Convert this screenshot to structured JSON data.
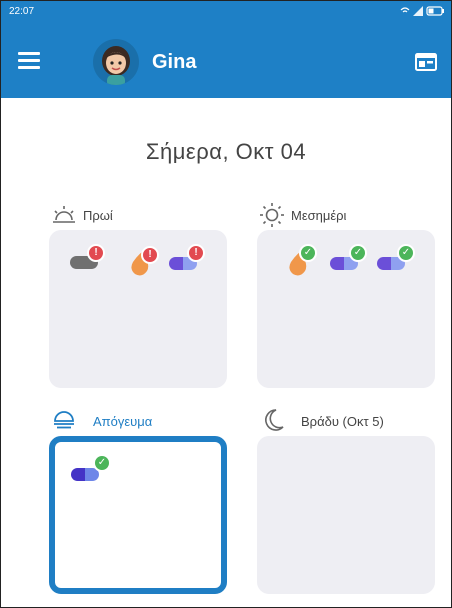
{
  "status_bar": {
    "time": "22:07"
  },
  "header": {
    "user_name": "Gina"
  },
  "date_title": "Σήμερα, Οκτ 04",
  "periods": [
    {
      "label": "Πρωί",
      "icon": "sunrise-icon",
      "items": [
        {
          "type": "pill",
          "colors": [
            "#707070",
            "#707070"
          ],
          "status": "missed"
        },
        {
          "type": "drop",
          "color": "#f0974a",
          "status": "missed"
        },
        {
          "type": "pill",
          "colors": [
            "#6b4fd8",
            "#8fa0f0"
          ],
          "status": "missed"
        }
      ]
    },
    {
      "label": "Μεσημέρι",
      "icon": "sun-icon",
      "items": [
        {
          "type": "drop",
          "color": "#f0974a",
          "status": "taken"
        },
        {
          "type": "pill",
          "colors": [
            "#6b4fd8",
            "#8fa0f0"
          ],
          "status": "taken"
        },
        {
          "type": "pill",
          "colors": [
            "#6b4fd8",
            "#8fa0f0"
          ],
          "status": "taken"
        }
      ]
    },
    {
      "label": "Απόγευμα",
      "icon": "sunset-icon",
      "selected": true,
      "items": [
        {
          "type": "pill",
          "colors": [
            "#4433c6",
            "#6e86e8"
          ],
          "status": "taken"
        }
      ]
    },
    {
      "label": "Βράδυ (Οκτ 5)",
      "icon": "moon-icon",
      "items": []
    }
  ],
  "colors": {
    "primary": "#1e80c6",
    "panel": "#eeeef3",
    "alert": "#e24a50",
    "ok": "#4cb55a"
  }
}
